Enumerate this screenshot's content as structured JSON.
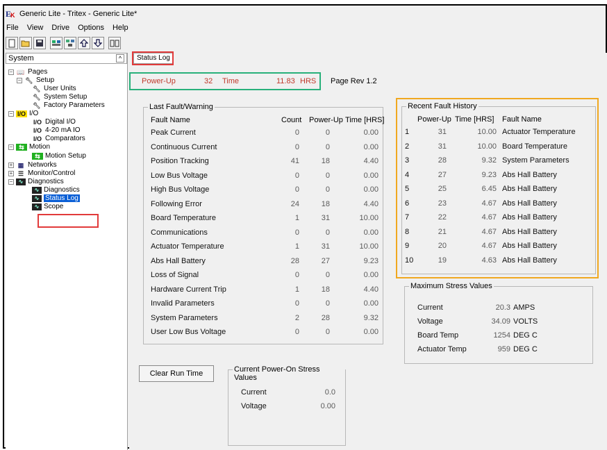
{
  "window": {
    "title": "Generic Lite - Tritex - Generic Lite*"
  },
  "menu": [
    "File",
    "View",
    "Drive",
    "Options",
    "Help"
  ],
  "toolbar": [
    "new-doc-icon",
    "open-folder-icon",
    "save-icon",
    "grid-icon",
    "network-icon",
    "upload-icon",
    "download-icon",
    "book-icon"
  ],
  "sidebar": {
    "header": "System",
    "pages": "Pages",
    "setup": "Setup",
    "user_units": "User Units",
    "system_setup": "System Setup",
    "factory_parameters": "Factory Parameters",
    "io": "I/O",
    "digital_io": "Digital I/O",
    "analog_io": "4-20 mA IO",
    "comparators": "Comparators",
    "motion": "Motion",
    "motion_setup": "Motion Setup",
    "networks": "Networks",
    "monitor_control": "Monitor/Control",
    "diagnostics": "Diagnostics",
    "diagnostics_page": "Diagnostics",
    "status_log": "Status Log",
    "scope": "Scope",
    "io_icon_text": "I/O"
  },
  "tab": {
    "label": "Status Log"
  },
  "header": {
    "power_up_label": "Power-Up",
    "power_up_value": "32",
    "time_label": "Time",
    "time_value": "11.83",
    "time_unit": "HRS",
    "page_rev": "Page Rev 1.2"
  },
  "last_fault": {
    "title": "Last Fault/Warning",
    "columns": [
      "Fault Name",
      "Count",
      "Power-Up",
      "Time  [HRS]"
    ],
    "rows": [
      {
        "name": "Peak Current",
        "count": "0",
        "power_up": "0",
        "time": "0.00"
      },
      {
        "name": "Continuous Current",
        "count": "0",
        "power_up": "0",
        "time": "0.00"
      },
      {
        "name": "Position Tracking",
        "count": "41",
        "power_up": "18",
        "time": "4.40"
      },
      {
        "name": "Low Bus Voltage",
        "count": "0",
        "power_up": "0",
        "time": "0.00"
      },
      {
        "name": "High Bus Voltage",
        "count": "0",
        "power_up": "0",
        "time": "0.00"
      },
      {
        "name": "Following Error",
        "count": "24",
        "power_up": "18",
        "time": "4.40"
      },
      {
        "name": "Board Temperature",
        "count": "1",
        "power_up": "31",
        "time": "10.00"
      },
      {
        "name": "Communications",
        "count": "0",
        "power_up": "0",
        "time": "0.00"
      },
      {
        "name": "Actuator Temperature",
        "count": "1",
        "power_up": "31",
        "time": "10.00"
      },
      {
        "name": "Abs Hall Battery",
        "count": "28",
        "power_up": "27",
        "time": "9.23"
      },
      {
        "name": "Loss of Signal",
        "count": "0",
        "power_up": "0",
        "time": "0.00"
      },
      {
        "name": "Hardware Current Trip",
        "count": "1",
        "power_up": "18",
        "time": "4.40"
      },
      {
        "name": "Invalid Parameters",
        "count": "0",
        "power_up": "0",
        "time": "0.00"
      },
      {
        "name": "System Parameters",
        "count": "2",
        "power_up": "28",
        "time": "9.32"
      },
      {
        "name": "User Low Bus Voltage",
        "count": "0",
        "power_up": "0",
        "time": "0.00"
      }
    ]
  },
  "recent": {
    "title": "Recent Fault History",
    "columns": [
      "Power-Up",
      "Time  [HRS]",
      "Fault Name"
    ],
    "rows": [
      {
        "idx": "1",
        "power_up": "31",
        "time": "10.00",
        "name": "Actuator Temperature"
      },
      {
        "idx": "2",
        "power_up": "31",
        "time": "10.00",
        "name": "Board Temperature"
      },
      {
        "idx": "3",
        "power_up": "28",
        "time": "9.32",
        "name": "System Parameters"
      },
      {
        "idx": "4",
        "power_up": "27",
        "time": "9.23",
        "name": "Abs Hall Battery"
      },
      {
        "idx": "5",
        "power_up": "25",
        "time": "6.45",
        "name": "Abs Hall Battery"
      },
      {
        "idx": "6",
        "power_up": "23",
        "time": "4.67",
        "name": "Abs Hall Battery"
      },
      {
        "idx": "7",
        "power_up": "22",
        "time": "4.67",
        "name": "Abs Hall Battery"
      },
      {
        "idx": "8",
        "power_up": "21",
        "time": "4.67",
        "name": "Abs Hall Battery"
      },
      {
        "idx": "9",
        "power_up": "20",
        "time": "4.67",
        "name": "Abs Hall Battery"
      },
      {
        "idx": "10",
        "power_up": "19",
        "time": "4.63",
        "name": "Abs Hall Battery"
      }
    ]
  },
  "max_stress": {
    "title": "Maximum Stress Values",
    "rows": [
      {
        "label": "Current",
        "value": "20.3",
        "unit": "AMPS"
      },
      {
        "label": "Voltage",
        "value": "34.09",
        "unit": "VOLTS"
      },
      {
        "label": "Board Temp",
        "value": "1254",
        "unit": "DEG C"
      },
      {
        "label": "Actuator Temp",
        "value": "959",
        "unit": "DEG C"
      }
    ]
  },
  "clear_button": "Clear Run Time",
  "power_on_stress": {
    "title": "Current Power-On Stress Values",
    "current_label": "Current",
    "current_value": "0.0",
    "voltage_label": "Voltage",
    "voltage_value": "0.00"
  },
  "colors": {
    "header_red": "#c0392b",
    "highlight_red": "#e23a3a",
    "highlight_green": "#28b07a",
    "highlight_orange": "#f0a820",
    "selection_blue": "#0a5fd6"
  }
}
